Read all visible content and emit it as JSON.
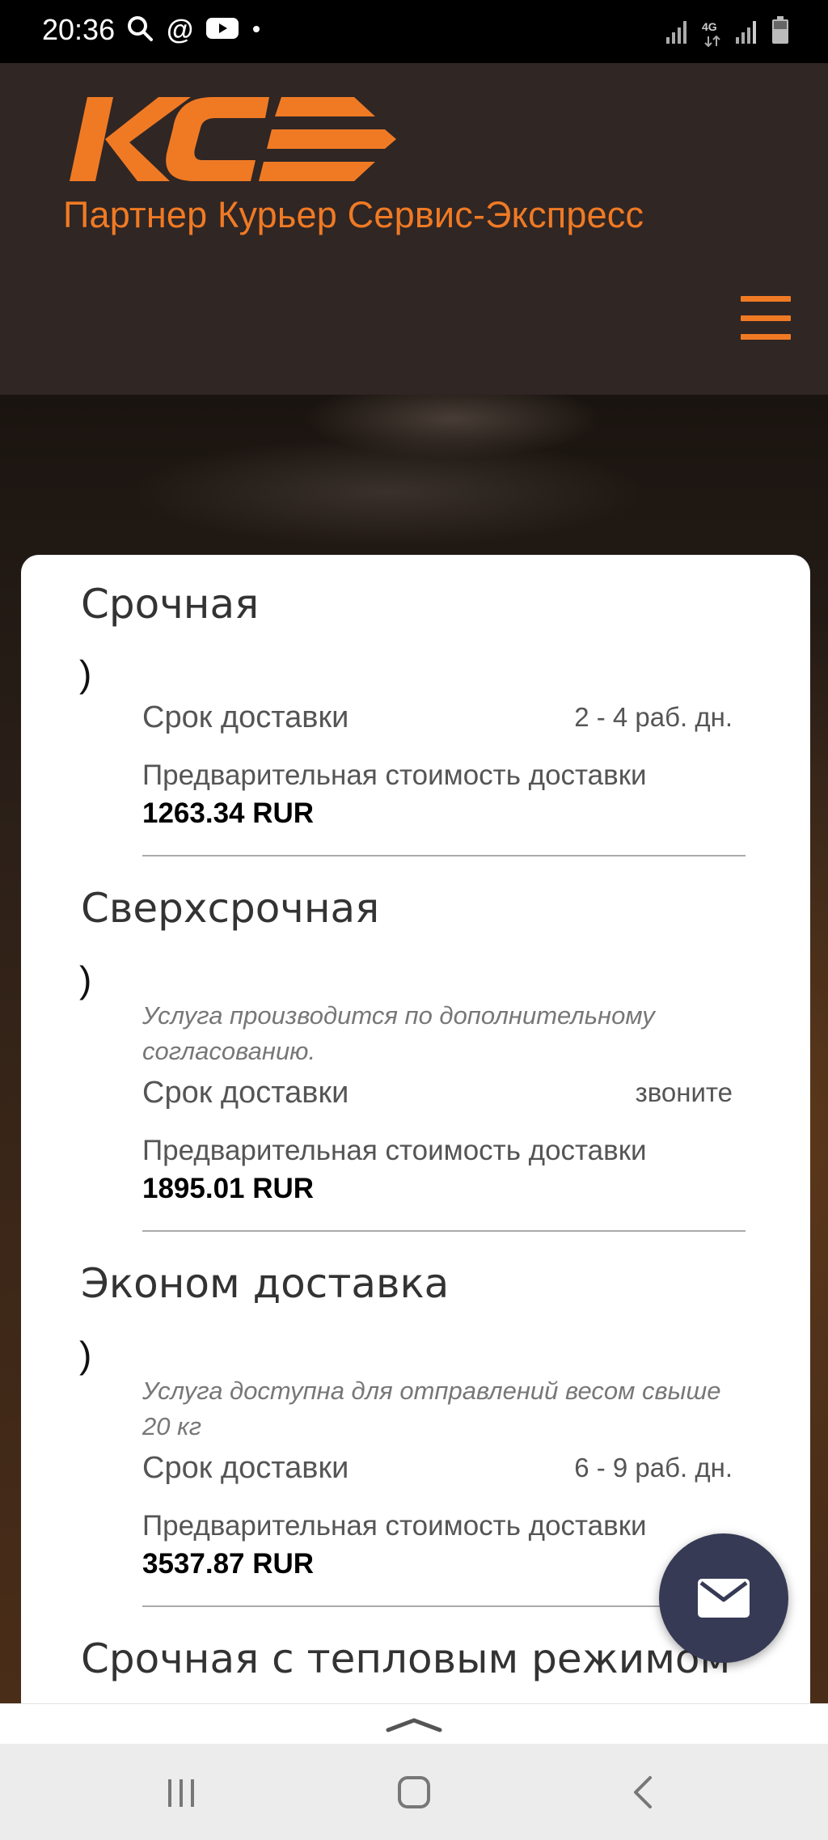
{
  "status_bar": {
    "time": "20:36",
    "left_icons": [
      "search-icon",
      "at-icon",
      "youtube-icon",
      "dot-icon"
    ],
    "network_label": "4G",
    "right_icons": [
      "signal-icon",
      "4g-icon",
      "signal-icon",
      "battery-icon"
    ]
  },
  "header": {
    "logo_text": "KC",
    "tagline": "Партнер Курьер Сервис-Экспресс",
    "menu_icon": "hamburger-icon",
    "accent_color": "#f07a24",
    "background_color": "#302624"
  },
  "tariffs": [
    {
      "title": "Срочная",
      "paren": ")",
      "note": "",
      "delivery_label": "Срок доставки",
      "delivery_value": "2 - 4 раб. дн.",
      "price_label": "Предварительная стоимость доставки",
      "price_value": "1263.34 RUR"
    },
    {
      "title": "Сверхсрочная",
      "paren": ")",
      "note": "Услуга производится по дополнительному согласованию.",
      "delivery_label": "Срок доставки",
      "delivery_value": "звоните",
      "price_label": "Предварительная стоимость доставки",
      "price_value": "1895.01 RUR"
    },
    {
      "title": "Эконом доставка",
      "paren": ")",
      "note": "Услуга доступна для отправлений весом свыше 20 кг",
      "delivery_label": "Срок доставки",
      "delivery_value": "6 - 9 раб. дн.",
      "price_label": "Предварительная стоимость доставки",
      "price_value": "3537.87 RUR"
    },
    {
      "title": "Срочная с тепловым режимом"
    }
  ],
  "fab": {
    "icon": "mail-icon",
    "color": "#373a55"
  },
  "drawer": {
    "icon": "chevron-up-icon"
  },
  "nav_bar": {
    "icons": [
      "recent-apps-icon",
      "home-icon",
      "back-icon"
    ]
  }
}
